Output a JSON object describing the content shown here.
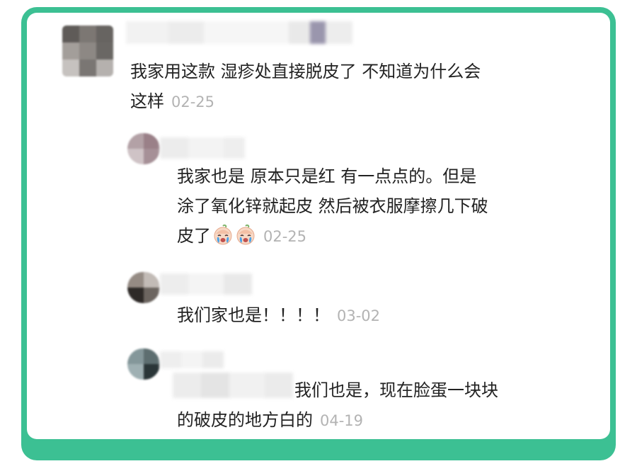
{
  "comments": [
    {
      "avatar_colors": [
        "#5f5b58",
        "#7c7773",
        "#676461",
        "#a39e9a",
        "#8d8884",
        "#6a6764",
        "#c6c2bf",
        "#7a7673",
        "#b5b1ae"
      ],
      "lines": [
        "我家用这款 湿疹处直接脱皮了 不知道为什么会",
        "这样"
      ],
      "time": "02-25"
    },
    {
      "avatar_colors": [
        "#b3a1a6",
        "#9a8088",
        "#cfc3c6",
        "#a69097"
      ],
      "lines": [
        "我家也是 原本只是红 有一点点的。但是",
        "涂了氧化锌就起皮 然后被衣服摩擦几下破",
        "皮了"
      ],
      "emoji": [
        "crying-baby-emoji",
        "crying-baby-emoji"
      ],
      "time": "02-25"
    },
    {
      "avatar_colors": [
        "#958b84",
        "#c2bbb6",
        "#2e2a28",
        "#6c6560"
      ],
      "lines": [
        "我们家也是！！！！"
      ],
      "time": "03-02"
    },
    {
      "avatar_colors": [
        "#84979a",
        "#5d6e70",
        "#9fb0b3",
        "#2a3638"
      ],
      "lines": [
        "我们也是，现在脸蛋一块块",
        "的破皮的地方白的"
      ],
      "time": "04-19"
    }
  ],
  "colors": {
    "frame": "#3cc093",
    "text": "#222222",
    "timestamp": "#b3b3b3"
  }
}
